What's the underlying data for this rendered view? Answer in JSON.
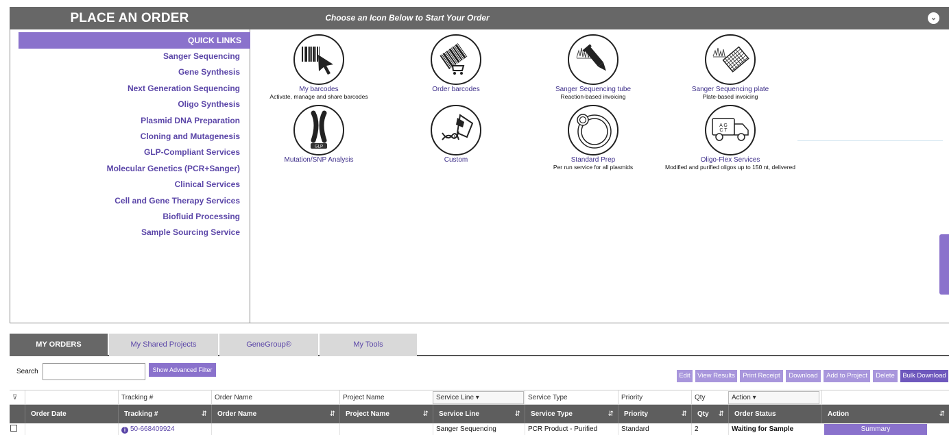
{
  "header": {
    "title": "PLACE AN ORDER",
    "subtitle": "Choose an Icon Below to Start Your Order",
    "collapse_icon": "chevron-down-icon"
  },
  "quick_links": {
    "heading": "QUICK LINKS",
    "items": [
      "Sanger Sequencing",
      "Gene Synthesis",
      "Next Generation Sequencing",
      "Oligo Synthesis",
      "Plasmid DNA Preparation",
      "Cloning and Mutagenesis",
      "GLP-Compliant Services",
      "Molecular Genetics (PCR+Sanger)",
      "Clinical Services",
      "Cell and Gene Therapy Services",
      "Biofluid Processing",
      "Sample Sourcing Service"
    ]
  },
  "tiles": [
    {
      "label": "My barcodes",
      "sub": "Activate, manage and share barcodes",
      "icon": "barcode-cursor-icon"
    },
    {
      "label": "Order barcodes",
      "sub": "",
      "icon": "barcode-cart-icon"
    },
    {
      "label": "Sanger Sequencing tube",
      "sub": "Reaction-based invoicing",
      "icon": "sequencing-tube-icon"
    },
    {
      "label": "Sanger Sequencing plate",
      "sub": "Plate-based invoicing",
      "icon": "sequencing-plate-icon"
    },
    {
      "label": "Mutation/SNP Analysis",
      "sub": "",
      "icon": "chromosome-icon",
      "badge": "GLP"
    },
    {
      "label": "Custom",
      "sub": "",
      "icon": "custom-dna-hand-icon"
    },
    {
      "label": "Standard Prep",
      "sub": "Per run service for all plasmids",
      "icon": "plasmid-icon"
    },
    {
      "label": "Oligo-Flex Services",
      "sub": "Modified and purified oligos up to 150 nt, delivered",
      "icon": "delivery-truck-icon"
    }
  ],
  "tabs": [
    "MY ORDERS",
    "My Shared Projects",
    "GeneGroup®",
    "My Tools"
  ],
  "search": {
    "label": "Search",
    "value": "",
    "placeholder": ""
  },
  "advanced_filter_label": "Show Advanced Filter",
  "actions": [
    "Edit",
    "View Results",
    "Print Receipt",
    "Download",
    "Add to Project",
    "Delete",
    "Bulk Download"
  ],
  "grid": {
    "filter_labels": [
      "Tracking #",
      "Order Name",
      "Project Name",
      "Service Line",
      "Service Type",
      "Priority",
      "Qty",
      "Action"
    ],
    "headers": [
      "Order Date",
      "Tracking #",
      "Order Name",
      "Project Name",
      "Service Line",
      "Service Type",
      "Priority",
      "Qty",
      "Order Status",
      "Action"
    ],
    "row": {
      "order_date": "",
      "tracking": "50-668409924",
      "order_name": "",
      "project_name": "",
      "service_line": "Sanger Sequencing",
      "service_type": "PCR Product - Purified",
      "priority": "Standard",
      "qty": "2",
      "status": "Waiting for Sample",
      "action": "Summary"
    }
  }
}
